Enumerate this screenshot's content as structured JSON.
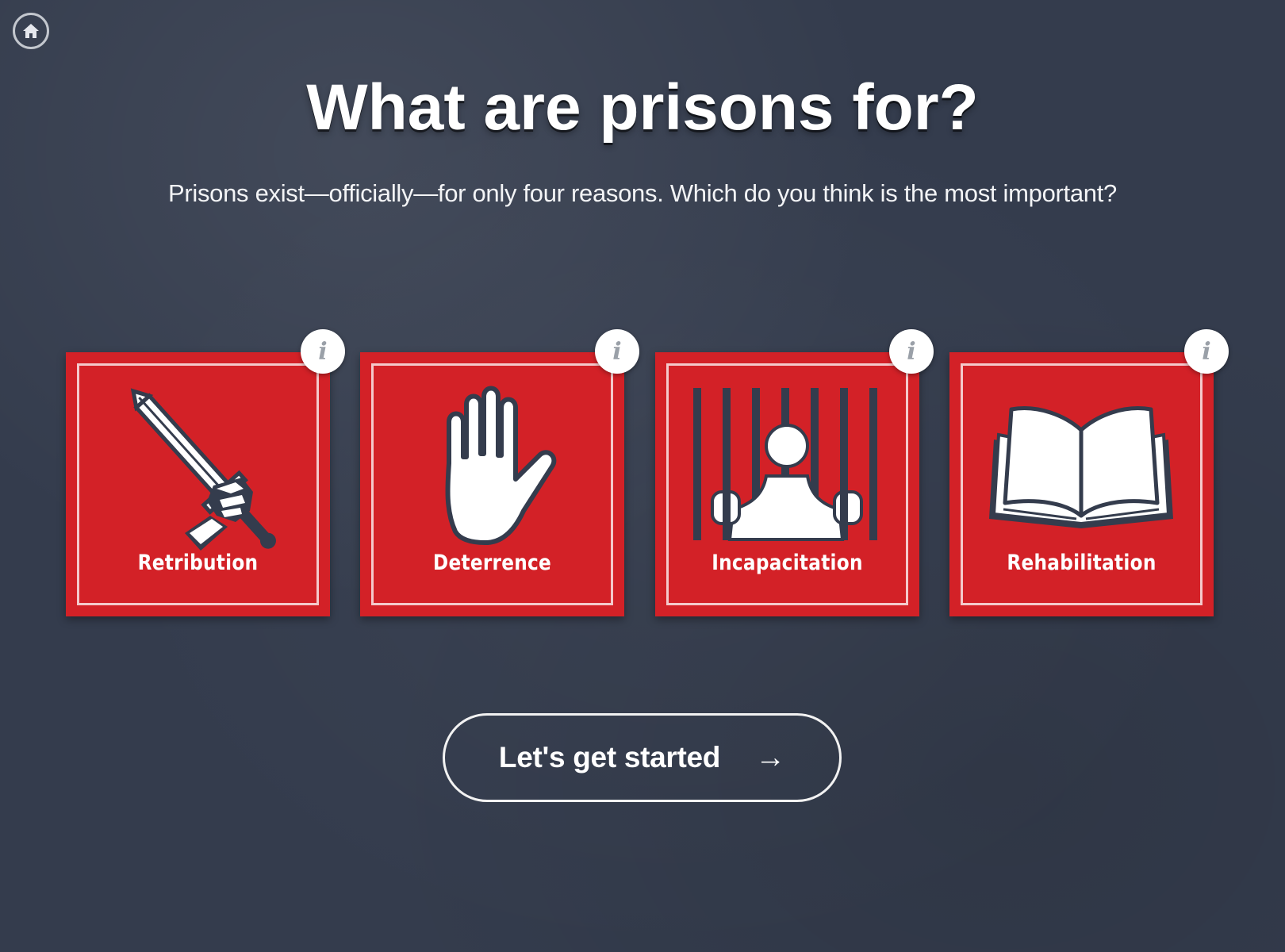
{
  "header": {
    "home_icon": "home-icon",
    "title": "What are prisons for?",
    "subtitle": "Prisons exist—officially—for only four reasons. Which do you think is the most important?"
  },
  "cards": [
    {
      "label": "Retribution",
      "icon": "sword-icon",
      "info": "i"
    },
    {
      "label": "Deterrence",
      "icon": "raised-hand-icon",
      "info": "i"
    },
    {
      "label": "Incapacitation",
      "icon": "prisoner-behind-bars-icon",
      "info": "i"
    },
    {
      "label": "Rehabilitation",
      "icon": "open-book-icon",
      "info": "i"
    }
  ],
  "cta": {
    "label": "Let's get started",
    "arrow": "→"
  },
  "colors": {
    "background": "#343c4d",
    "card_red": "#d32127",
    "text": "#ffffff"
  }
}
